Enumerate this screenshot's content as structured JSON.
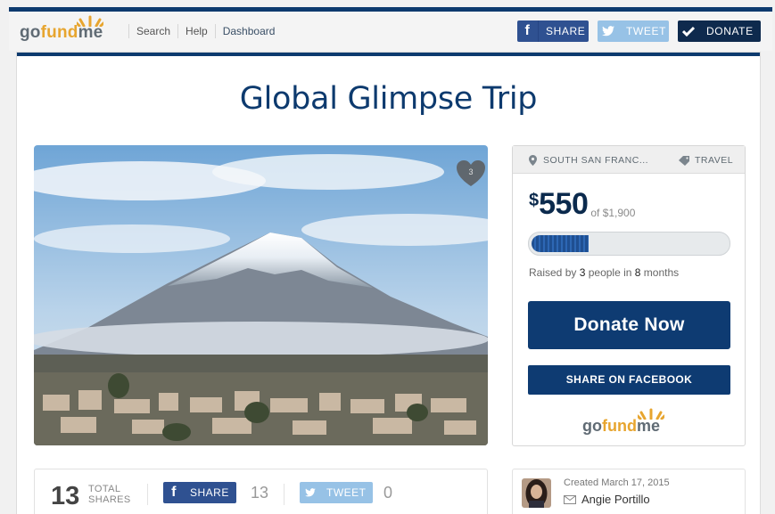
{
  "header": {
    "logo": {
      "go": "go",
      "fund": "fund",
      "me": "me"
    },
    "nav": [
      "Search",
      "Help",
      "Dashboard"
    ],
    "share_label": "SHARE",
    "tweet_label": "TWEET",
    "donate_label": "DONATE",
    "icons": {
      "share": "facebook-icon",
      "tweet": "twitter-icon",
      "donate": "checkmark-icon"
    }
  },
  "campaign": {
    "title": "Global Glimpse Trip",
    "heart_count": "3",
    "location": "SOUTH SAN FRANC...",
    "category": "TRAVEL",
    "currency": "$",
    "raised": "550",
    "goal_text": "of $1,900",
    "progress_fraction": 0.29,
    "raised_by_prefix": "Raised by ",
    "raised_by_people": "3",
    "raised_by_middle": " people in ",
    "raised_by_months": "8",
    "raised_by_suffix": " months",
    "donate_now_label": "Donate Now",
    "share_facebook_label": "SHARE ON FACEBOOK"
  },
  "shares": {
    "total": "13",
    "total_label_1": "TOTAL",
    "total_label_2": "SHARES",
    "fb_label": "SHARE",
    "fb_count": "13",
    "tw_label": "TWEET",
    "tw_count": "0"
  },
  "creator": {
    "created": "Created March 17, 2015",
    "name": "Angie Portillo"
  },
  "colors": {
    "brand_navy": "#0d3a6e",
    "facebook": "#2f5191",
    "twitter": "#97c2e6",
    "gofundme_orange": "#e7a52f"
  }
}
